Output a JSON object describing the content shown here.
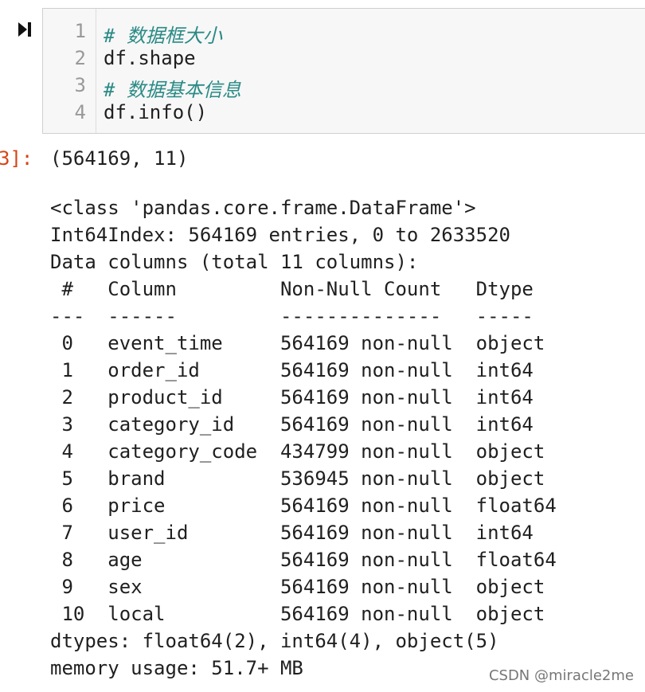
{
  "input_cell": {
    "run_icon": "run-next-icon",
    "lines": [
      {
        "num": "1",
        "text": "# 数据框大小",
        "type": "comment"
      },
      {
        "num": "2",
        "text": "df.shape",
        "type": "code"
      },
      {
        "num": "3",
        "text": "# 数据基本信息",
        "type": "comment"
      },
      {
        "num": "4",
        "text": "df.info()",
        "type": "code"
      }
    ]
  },
  "output": {
    "prompt": "3]:",
    "shape_result": "(564169, 11)",
    "info_lines": [
      "<class 'pandas.core.frame.DataFrame'>",
      "Int64Index: 564169 entries, 0 to 2633520",
      "Data columns (total 11 columns):",
      " #   Column         Non-Null Count   Dtype",
      "---  ------         --------------   -----",
      " 0   event_time     564169 non-null  object",
      " 1   order_id       564169 non-null  int64",
      " 2   product_id     564169 non-null  int64",
      " 3   category_id    564169 non-null  int64",
      " 4   category_code  434799 non-null  object",
      " 5   brand          536945 non-null  object",
      " 6   price          564169 non-null  float64",
      " 7   user_id        564169 non-null  int64",
      " 8   age            564169 non-null  float64",
      " 9   sex            564169 non-null  object",
      " 10  local          564169 non-null  object",
      "dtypes: float64(2), int64(4), object(5)",
      "memory usage: 51.7+ MB"
    ]
  },
  "watermark": "CSDN @miracle2me",
  "colors": {
    "comment": "#2a8a85",
    "prompt": "#d84315",
    "cell_bg": "#f7f7f7",
    "cell_border": "#cfcfcf"
  }
}
